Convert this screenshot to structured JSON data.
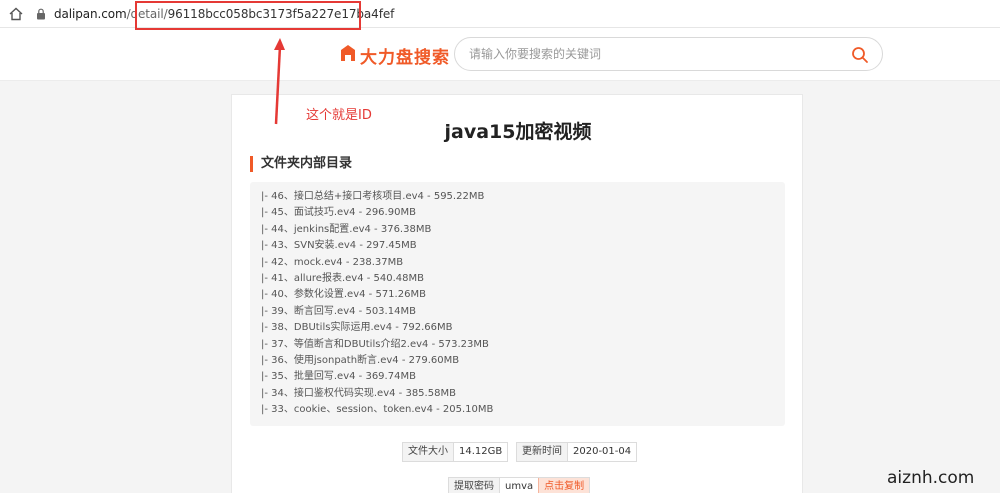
{
  "browser": {
    "host": "dalipan.com",
    "path": "/detail/",
    "id": "96118bcc058bc3173f5a227e17ba4fef"
  },
  "header": {
    "logo_text": "大力盘搜索",
    "search_placeholder": "请输入你要搜索的关键词"
  },
  "annotation": {
    "label": "这个就是ID",
    "color": "#e53935"
  },
  "main": {
    "title": "java15加密视频",
    "section_heading": "文件夹内部目录",
    "files": [
      "|- 46、接口总结+接口考核项目.ev4 - 595.22MB",
      "|- 45、面试技巧.ev4 - 296.90MB",
      "|- 44、jenkins配置.ev4 - 376.38MB",
      "|- 43、SVN安装.ev4 - 297.45MB",
      "|- 42、mock.ev4 - 238.37MB",
      "|- 41、allure报表.ev4 - 540.48MB",
      "|- 40、参数化设置.ev4 - 571.26MB",
      "|- 39、断言回写.ev4 - 503.14MB",
      "|- 38、DBUtils实际运用.ev4 - 792.66MB",
      "|- 37、等值断言和DBUtils介绍2.ev4 - 573.23MB",
      "|- 36、使用jsonpath断言.ev4 - 279.60MB",
      "|- 35、批量回写.ev4 - 369.74MB",
      "|- 34、接口鉴权代码实现.ev4 - 385.58MB",
      "|- 33、cookie、session、token.ev4 - 205.10MB"
    ],
    "meta": {
      "size_label": "文件大小",
      "size_value": "14.12GB",
      "time_label": "更新时间",
      "time_value": "2020-01-04"
    },
    "password": {
      "label": "提取密码",
      "value": "umva",
      "copy_label": "点击复制"
    }
  },
  "watermark": "aiznh.com",
  "colors": {
    "accent": "#f05a28",
    "annotation_red": "#e53935"
  },
  "icons": [
    "home-icon",
    "lock-icon",
    "logo-icon",
    "search-icon"
  ]
}
